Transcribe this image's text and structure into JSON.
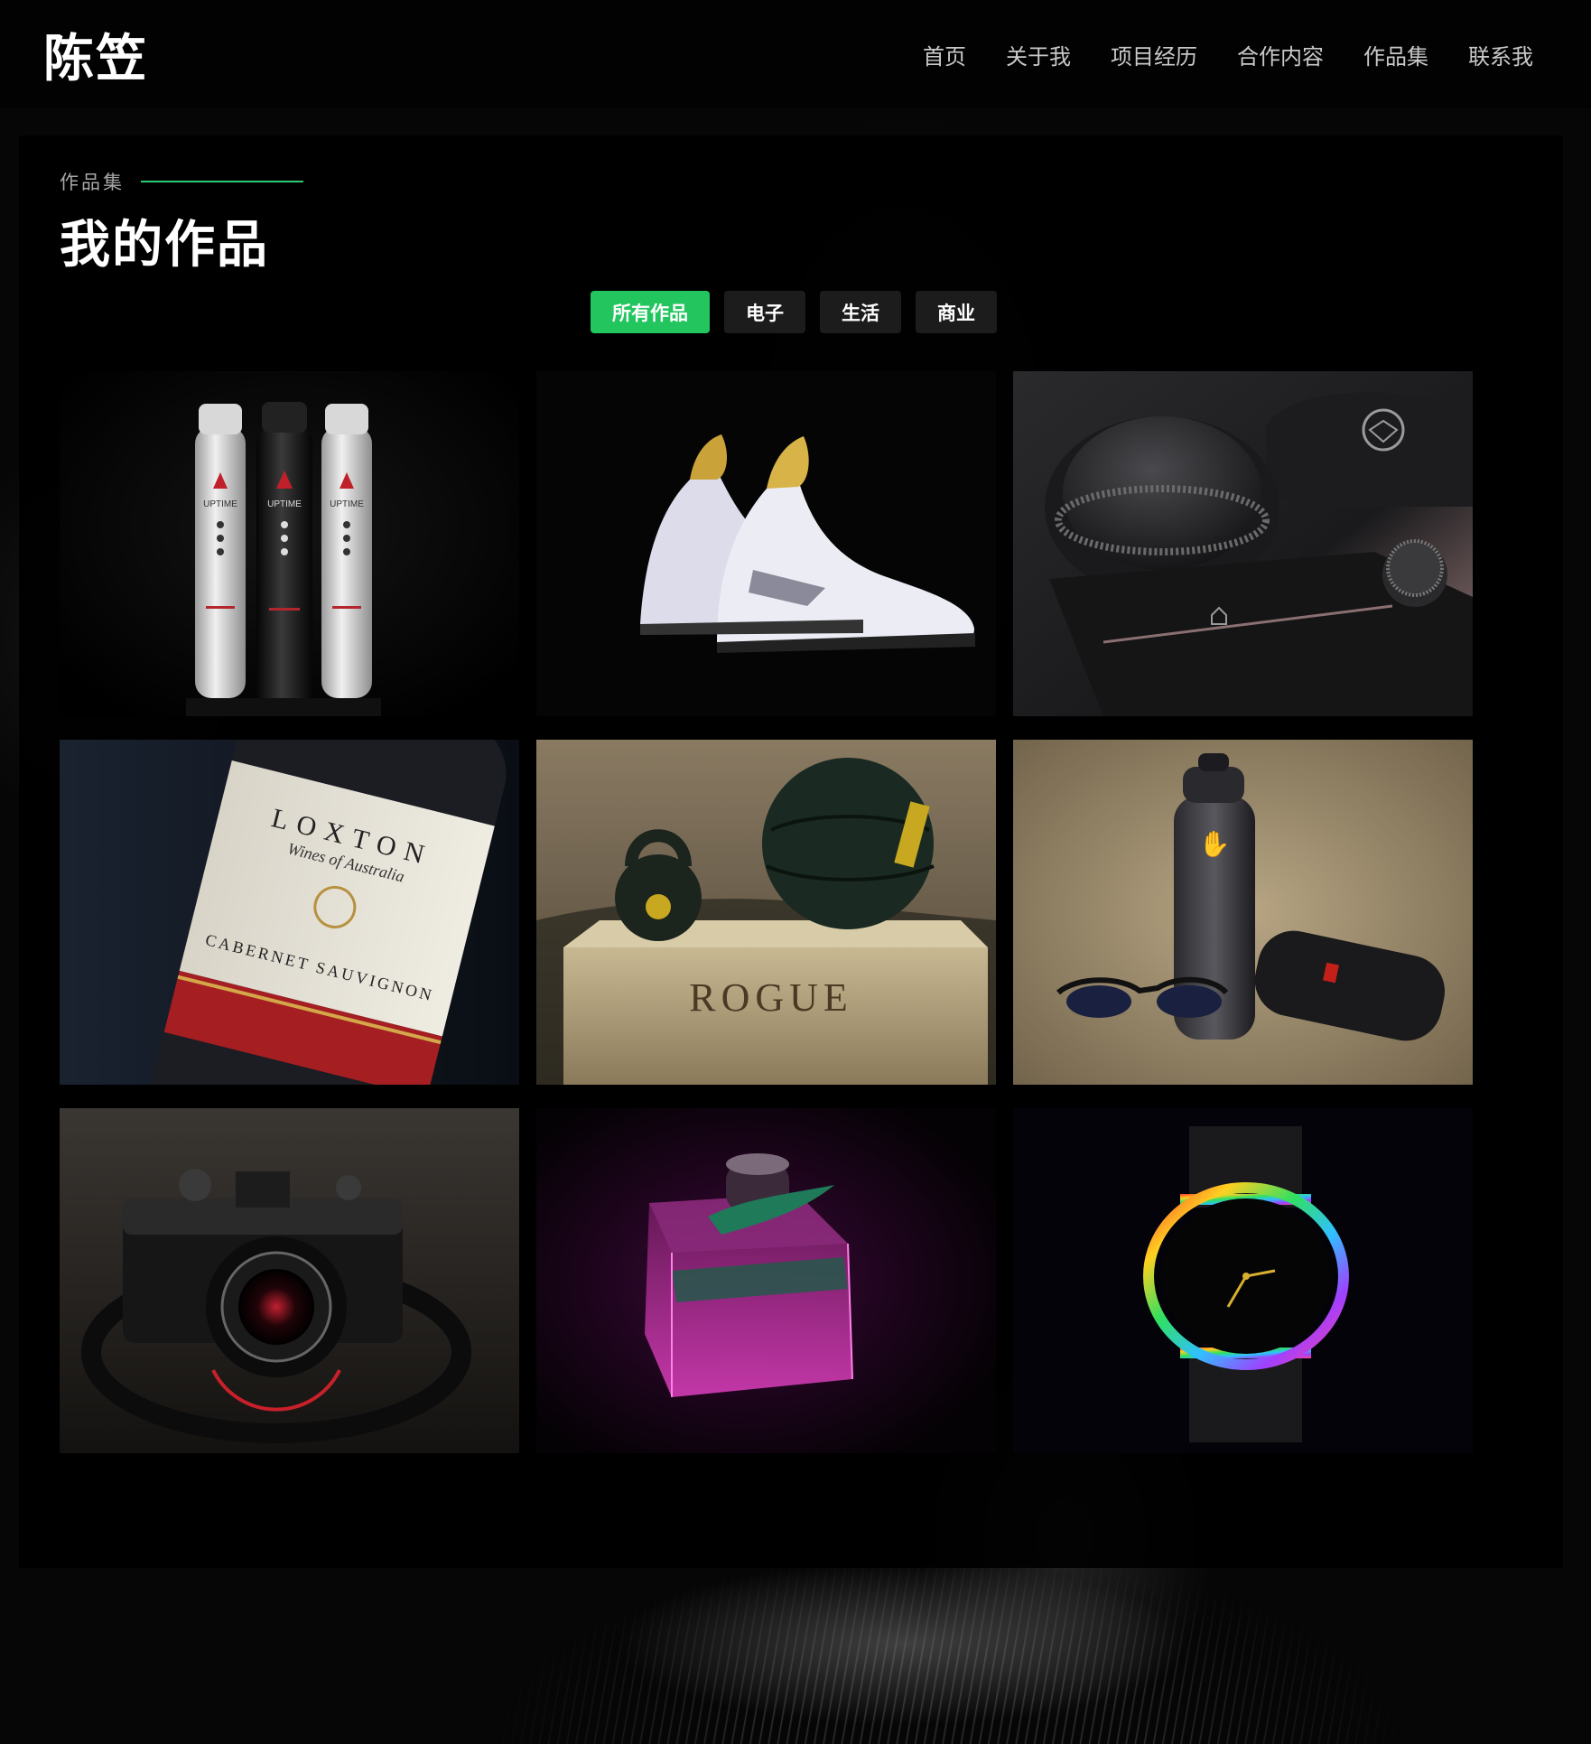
{
  "header": {
    "brand": "陈笠",
    "nav": [
      {
        "label": "首页"
      },
      {
        "label": "关于我"
      },
      {
        "label": "项目经历"
      },
      {
        "label": "合作内容"
      },
      {
        "label": "作品集"
      },
      {
        "label": "联系我"
      }
    ]
  },
  "portfolio": {
    "eyebrow": "作品集",
    "title": "我的作品",
    "filters": [
      {
        "label": "所有作品",
        "active": true
      },
      {
        "label": "电子",
        "active": false
      },
      {
        "label": "生活",
        "active": false
      },
      {
        "label": "商业",
        "active": false
      }
    ],
    "items": [
      {
        "subject": "energy drink bottles",
        "icon": "bottles-photo",
        "brand_text": "UPTIME"
      },
      {
        "subject": "sneakers",
        "icon": "sneakers-photo"
      },
      {
        "subject": "car console knob",
        "icon": "car-console-photo"
      },
      {
        "subject": "wine bottle",
        "icon": "wine-bottle-photo",
        "brand_text": "LOXTON",
        "sub_text": "Wines of Australia",
        "variety_text": "CABERNET SAUVIGNON"
      },
      {
        "subject": "kettlebell and medicine ball",
        "icon": "fitness-gear-photo",
        "brand_text": "ROGUE"
      },
      {
        "subject": "water bottle and speaker",
        "icon": "water-bottle-photo"
      },
      {
        "subject": "film camera",
        "icon": "camera-photo"
      },
      {
        "subject": "perfume bottle",
        "icon": "perfume-photo"
      },
      {
        "subject": "wristwatch",
        "icon": "watch-photo"
      }
    ]
  },
  "colors": {
    "accent": "#22c55e",
    "accent_line": "#2ecc71",
    "background": "#000000",
    "nav_text": "#c9c9c9",
    "filter_inactive": "#1c1c1c"
  }
}
